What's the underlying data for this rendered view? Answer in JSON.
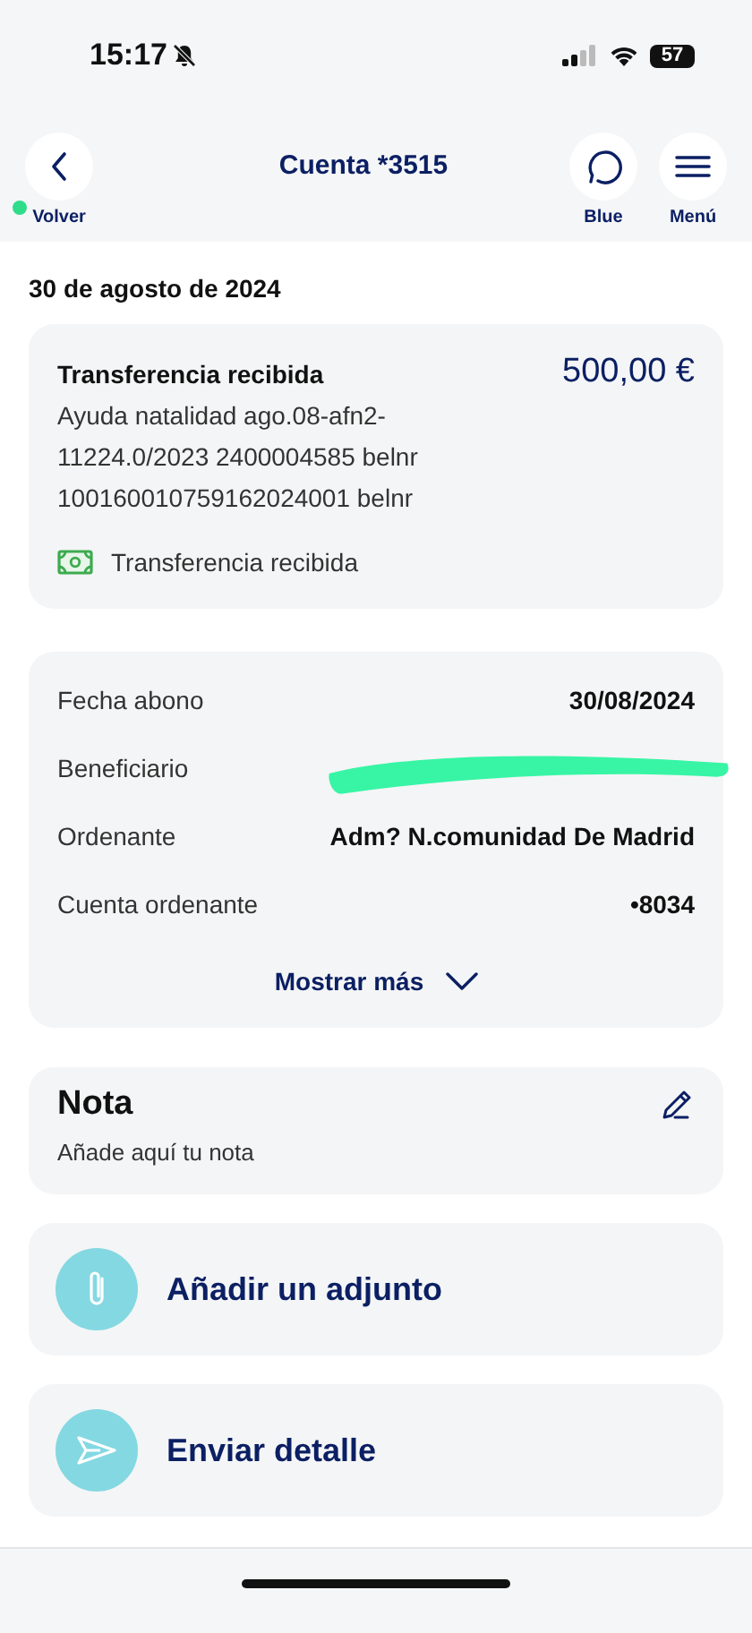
{
  "status_bar": {
    "time": "15:17",
    "silent": true,
    "battery": "57"
  },
  "header": {
    "title": "Cuenta *3515",
    "back_label": "Volver",
    "actions": [
      {
        "kind": "chat",
        "label": "Blue"
      },
      {
        "kind": "menu",
        "label": "Menú"
      }
    ]
  },
  "date": "30 de agosto de 2024",
  "transaction": {
    "title": "Transferencia recibida",
    "amount": "500,00 €",
    "description": "Ayuda natalidad ago.08-afn2-11224.0/2023 2400004585 belnr 100160010759162024001 belnr",
    "category": "Transferencia recibida"
  },
  "details": {
    "rows": [
      {
        "label": "Fecha abono",
        "value": "30/08/2024",
        "redacted": false
      },
      {
        "label": "Beneficiario",
        "redacted": true
      },
      {
        "label": "Ordenante",
        "value": "Adm? N.comunidad De Madrid",
        "redacted": false
      },
      {
        "label": "Cuenta ordenante",
        "value": "•8034",
        "redacted": false
      }
    ],
    "show_more": "Mostrar más"
  },
  "note": {
    "title": "Nota",
    "placeholder": "Añade aquí tu nota"
  },
  "actions": [
    {
      "kind": "attach",
      "label": "Añadir un adjunto"
    },
    {
      "kind": "send",
      "label": "Enviar detalle"
    }
  ]
}
